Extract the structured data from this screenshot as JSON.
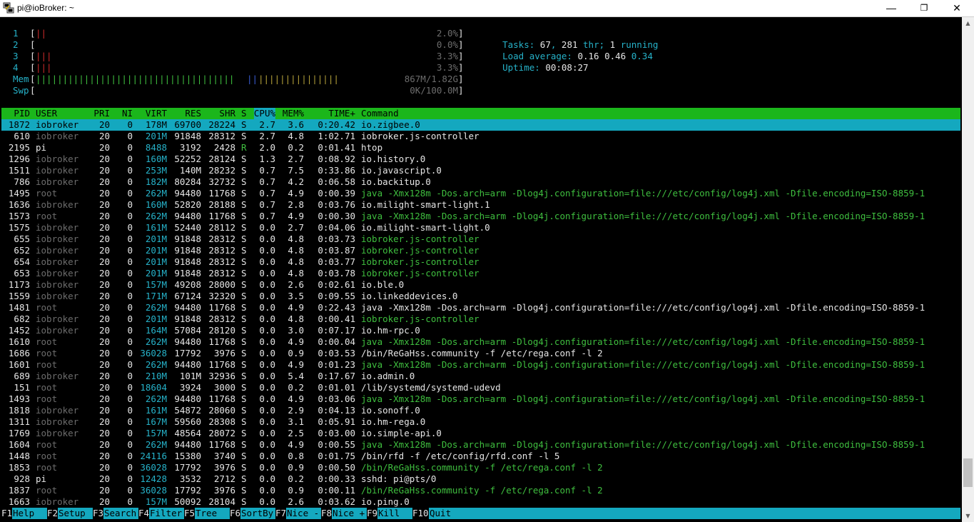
{
  "window": {
    "title": "pi@ioBroker: ~",
    "minimize_glyph": "—",
    "restore_glyph": "❐",
    "close_glyph": "✕",
    "icon": "putty-icon"
  },
  "meters": {
    "cpus": [
      {
        "label": "1",
        "open": "[",
        "bars": "||",
        "value": "2.0%",
        "close": "]"
      },
      {
        "label": "2",
        "open": "[",
        "bars": "",
        "value": "0.0%",
        "close": "]"
      },
      {
        "label": "3",
        "open": "[",
        "bars": "|||",
        "value": "3.3%",
        "close": "]"
      },
      {
        "label": "4",
        "open": "[",
        "bars": "|||",
        "value": "3.3%",
        "close": "]"
      }
    ],
    "mem": {
      "label": "Mem",
      "open": "[",
      "bars_green": "|||||||||||||||||||||||||||||||||||||",
      "bars_blue": "||",
      "bars_yellow": "|||||||||||||||",
      "value": "867M/1.82G",
      "close": "]"
    },
    "swp": {
      "label": "Swp",
      "open": "[",
      "value": "0K/100.0M",
      "close": "]"
    }
  },
  "stats": {
    "tasks_label": "Tasks: ",
    "tasks": "67",
    "thr_sep": ", ",
    "thr": "281",
    "thr_label": " thr; ",
    "running": "1",
    "running_label": " running",
    "load_label": "Load average: ",
    "load1": "0.16",
    "load5": "0.46",
    "load15": "0.34",
    "uptime_label": "Uptime: ",
    "uptime": "00:08:27"
  },
  "columns": {
    "pid": "PID",
    "user": "USER",
    "pri": "PRI",
    "ni": "NI",
    "virt": "VIRT",
    "res": "RES",
    "shr": "SHR",
    "s": "S",
    "cpu": "CPU%",
    "mem": "MEM%",
    "time": "TIME+",
    "command": "Command"
  },
  "processes": [
    {
      "pid": "1872",
      "user": "iobroker",
      "pri": "20",
      "ni": "0",
      "virt": "178M",
      "res": "69700",
      "shr": "28224",
      "s": "S",
      "cpu": "2.7",
      "mem": "3.6",
      "time": "0:20.42",
      "command": "io.zigbee.0",
      "thread": false,
      "selected": true
    },
    {
      "pid": "610",
      "user": "iobroker",
      "pri": "20",
      "ni": "0",
      "virt": "201M",
      "res": "91848",
      "shr": "28312",
      "s": "S",
      "cpu": "2.7",
      "mem": "4.8",
      "time": "1:02.71",
      "command": "iobroker.js-controller",
      "thread": false
    },
    {
      "pid": "2195",
      "user": "pi",
      "pri": "20",
      "ni": "0",
      "virt": "8488",
      "res": "3192",
      "shr": "2428",
      "s": "R",
      "cpu": "2.0",
      "mem": "0.2",
      "time": "0:01.41",
      "command": "htop",
      "thread": false
    },
    {
      "pid": "1296",
      "user": "iobroker",
      "pri": "20",
      "ni": "0",
      "virt": "160M",
      "res": "52252",
      "shr": "28124",
      "s": "S",
      "cpu": "1.3",
      "mem": "2.7",
      "time": "0:08.92",
      "command": "io.history.0",
      "thread": false
    },
    {
      "pid": "1511",
      "user": "iobroker",
      "pri": "20",
      "ni": "0",
      "virt": "253M",
      "res": "140M",
      "shr": "28232",
      "s": "S",
      "cpu": "0.7",
      "mem": "7.5",
      "time": "0:33.86",
      "command": "io.javascript.0",
      "thread": false
    },
    {
      "pid": "786",
      "user": "iobroker",
      "pri": "20",
      "ni": "0",
      "virt": "182M",
      "res": "80284",
      "shr": "32732",
      "s": "S",
      "cpu": "0.7",
      "mem": "4.2",
      "time": "0:06.58",
      "command": "io.backitup.0",
      "thread": false
    },
    {
      "pid": "1495",
      "user": "root",
      "pri": "20",
      "ni": "0",
      "virt": "262M",
      "res": "94480",
      "shr": "11768",
      "s": "S",
      "cpu": "0.7",
      "mem": "4.9",
      "time": "0:00.39",
      "command": "java -Xmx128m -Dos.arch=arm -Dlog4j.configuration=file:///etc/config/log4j.xml -Dfile.encoding=ISO-8859-1",
      "thread": true
    },
    {
      "pid": "1636",
      "user": "iobroker",
      "pri": "20",
      "ni": "0",
      "virt": "160M",
      "res": "52820",
      "shr": "28188",
      "s": "S",
      "cpu": "0.7",
      "mem": "2.8",
      "time": "0:03.76",
      "command": "io.milight-smart-light.1",
      "thread": false
    },
    {
      "pid": "1573",
      "user": "root",
      "pri": "20",
      "ni": "0",
      "virt": "262M",
      "res": "94480",
      "shr": "11768",
      "s": "S",
      "cpu": "0.7",
      "mem": "4.9",
      "time": "0:00.30",
      "command": "java -Xmx128m -Dos.arch=arm -Dlog4j.configuration=file:///etc/config/log4j.xml -Dfile.encoding=ISO-8859-1",
      "thread": true
    },
    {
      "pid": "1575",
      "user": "iobroker",
      "pri": "20",
      "ni": "0",
      "virt": "161M",
      "res": "52440",
      "shr": "28112",
      "s": "S",
      "cpu": "0.0",
      "mem": "2.7",
      "time": "0:04.06",
      "command": "io.milight-smart-light.0",
      "thread": false
    },
    {
      "pid": "655",
      "user": "iobroker",
      "pri": "20",
      "ni": "0",
      "virt": "201M",
      "res": "91848",
      "shr": "28312",
      "s": "S",
      "cpu": "0.0",
      "mem": "4.8",
      "time": "0:03.73",
      "command": "iobroker.js-controller",
      "thread": true
    },
    {
      "pid": "652",
      "user": "iobroker",
      "pri": "20",
      "ni": "0",
      "virt": "201M",
      "res": "91848",
      "shr": "28312",
      "s": "S",
      "cpu": "0.0",
      "mem": "4.8",
      "time": "0:03.87",
      "command": "iobroker.js-controller",
      "thread": true
    },
    {
      "pid": "654",
      "user": "iobroker",
      "pri": "20",
      "ni": "0",
      "virt": "201M",
      "res": "91848",
      "shr": "28312",
      "s": "S",
      "cpu": "0.0",
      "mem": "4.8",
      "time": "0:03.77",
      "command": "iobroker.js-controller",
      "thread": true
    },
    {
      "pid": "653",
      "user": "iobroker",
      "pri": "20",
      "ni": "0",
      "virt": "201M",
      "res": "91848",
      "shr": "28312",
      "s": "S",
      "cpu": "0.0",
      "mem": "4.8",
      "time": "0:03.78",
      "command": "iobroker.js-controller",
      "thread": true
    },
    {
      "pid": "1173",
      "user": "iobroker",
      "pri": "20",
      "ni": "0",
      "virt": "157M",
      "res": "49208",
      "shr": "28000",
      "s": "S",
      "cpu": "0.0",
      "mem": "2.6",
      "time": "0:02.61",
      "command": "io.ble.0",
      "thread": false
    },
    {
      "pid": "1559",
      "user": "iobroker",
      "pri": "20",
      "ni": "0",
      "virt": "171M",
      "res": "67124",
      "shr": "32320",
      "s": "S",
      "cpu": "0.0",
      "mem": "3.5",
      "time": "0:09.55",
      "command": "io.linkeddevices.0",
      "thread": false
    },
    {
      "pid": "1481",
      "user": "root",
      "pri": "20",
      "ni": "0",
      "virt": "262M",
      "res": "94480",
      "shr": "11768",
      "s": "S",
      "cpu": "0.0",
      "mem": "4.9",
      "time": "0:22.43",
      "command": "java -Xmx128m -Dos.arch=arm -Dlog4j.configuration=file:///etc/config/log4j.xml -Dfile.encoding=ISO-8859-1",
      "thread": false
    },
    {
      "pid": "682",
      "user": "iobroker",
      "pri": "20",
      "ni": "0",
      "virt": "201M",
      "res": "91848",
      "shr": "28312",
      "s": "S",
      "cpu": "0.0",
      "mem": "4.8",
      "time": "0:00.41",
      "command": "iobroker.js-controller",
      "thread": true
    },
    {
      "pid": "1452",
      "user": "iobroker",
      "pri": "20",
      "ni": "0",
      "virt": "164M",
      "res": "57084",
      "shr": "28120",
      "s": "S",
      "cpu": "0.0",
      "mem": "3.0",
      "time": "0:07.17",
      "command": "io.hm-rpc.0",
      "thread": false
    },
    {
      "pid": "1610",
      "user": "root",
      "pri": "20",
      "ni": "0",
      "virt": "262M",
      "res": "94480",
      "shr": "11768",
      "s": "S",
      "cpu": "0.0",
      "mem": "4.9",
      "time": "0:00.04",
      "command": "java -Xmx128m -Dos.arch=arm -Dlog4j.configuration=file:///etc/config/log4j.xml -Dfile.encoding=ISO-8859-1",
      "thread": true
    },
    {
      "pid": "1686",
      "user": "root",
      "pri": "20",
      "ni": "0",
      "virt": "36028",
      "res": "17792",
      "shr": "3976",
      "s": "S",
      "cpu": "0.0",
      "mem": "0.9",
      "time": "0:03.53",
      "command": "/bin/ReGaHss.community -f /etc/rega.conf -l 2",
      "thread": false
    },
    {
      "pid": "1601",
      "user": "root",
      "pri": "20",
      "ni": "0",
      "virt": "262M",
      "res": "94480",
      "shr": "11768",
      "s": "S",
      "cpu": "0.0",
      "mem": "4.9",
      "time": "0:01.23",
      "command": "java -Xmx128m -Dos.arch=arm -Dlog4j.configuration=file:///etc/config/log4j.xml -Dfile.encoding=ISO-8859-1",
      "thread": true
    },
    {
      "pid": "689",
      "user": "iobroker",
      "pri": "20",
      "ni": "0",
      "virt": "210M",
      "res": "101M",
      "shr": "32936",
      "s": "S",
      "cpu": "0.0",
      "mem": "5.4",
      "time": "0:17.67",
      "command": "io.admin.0",
      "thread": false
    },
    {
      "pid": "151",
      "user": "root",
      "pri": "20",
      "ni": "0",
      "virt": "18604",
      "res": "3924",
      "shr": "3000",
      "s": "S",
      "cpu": "0.0",
      "mem": "0.2",
      "time": "0:01.01",
      "command": "/lib/systemd/systemd-udevd",
      "thread": false
    },
    {
      "pid": "1493",
      "user": "root",
      "pri": "20",
      "ni": "0",
      "virt": "262M",
      "res": "94480",
      "shr": "11768",
      "s": "S",
      "cpu": "0.0",
      "mem": "4.9",
      "time": "0:03.06",
      "command": "java -Xmx128m -Dos.arch=arm -Dlog4j.configuration=file:///etc/config/log4j.xml -Dfile.encoding=ISO-8859-1",
      "thread": true
    },
    {
      "pid": "1818",
      "user": "iobroker",
      "pri": "20",
      "ni": "0",
      "virt": "161M",
      "res": "54872",
      "shr": "28060",
      "s": "S",
      "cpu": "0.0",
      "mem": "2.9",
      "time": "0:04.13",
      "command": "io.sonoff.0",
      "thread": false
    },
    {
      "pid": "1311",
      "user": "iobroker",
      "pri": "20",
      "ni": "0",
      "virt": "167M",
      "res": "59560",
      "shr": "28308",
      "s": "S",
      "cpu": "0.0",
      "mem": "3.1",
      "time": "0:05.91",
      "command": "io.hm-rega.0",
      "thread": false
    },
    {
      "pid": "1769",
      "user": "iobroker",
      "pri": "20",
      "ni": "0",
      "virt": "157M",
      "res": "48564",
      "shr": "28072",
      "s": "S",
      "cpu": "0.0",
      "mem": "2.5",
      "time": "0:03.00",
      "command": "io.simple-api.0",
      "thread": false
    },
    {
      "pid": "1604",
      "user": "root",
      "pri": "20",
      "ni": "0",
      "virt": "262M",
      "res": "94480",
      "shr": "11768",
      "s": "S",
      "cpu": "0.0",
      "mem": "4.9",
      "time": "0:00.55",
      "command": "java -Xmx128m -Dos.arch=arm -Dlog4j.configuration=file:///etc/config/log4j.xml -Dfile.encoding=ISO-8859-1",
      "thread": true
    },
    {
      "pid": "1448",
      "user": "root",
      "pri": "20",
      "ni": "0",
      "virt": "24116",
      "res": "15380",
      "shr": "3740",
      "s": "S",
      "cpu": "0.0",
      "mem": "0.8",
      "time": "0:01.75",
      "command": "/bin/rfd -f /etc/config/rfd.conf -l 5",
      "thread": false
    },
    {
      "pid": "1853",
      "user": "root",
      "pri": "20",
      "ni": "0",
      "virt": "36028",
      "res": "17792",
      "shr": "3976",
      "s": "S",
      "cpu": "0.0",
      "mem": "0.9",
      "time": "0:00.50",
      "command": "/bin/ReGaHss.community -f /etc/rega.conf -l 2",
      "thread": true
    },
    {
      "pid": "928",
      "user": "pi",
      "pri": "20",
      "ni": "0",
      "virt": "12428",
      "res": "3532",
      "shr": "2712",
      "s": "S",
      "cpu": "0.0",
      "mem": "0.2",
      "time": "0:00.33",
      "command": "sshd: pi@pts/0",
      "thread": false
    },
    {
      "pid": "1837",
      "user": "root",
      "pri": "20",
      "ni": "0",
      "virt": "36028",
      "res": "17792",
      "shr": "3976",
      "s": "S",
      "cpu": "0.0",
      "mem": "0.9",
      "time": "0:00.11",
      "command": "/bin/ReGaHss.community -f /etc/rega.conf -l 2",
      "thread": true
    },
    {
      "pid": "1663",
      "user": "iobroker",
      "pri": "20",
      "ni": "0",
      "virt": "157M",
      "res": "50092",
      "shr": "28104",
      "s": "S",
      "cpu": "0.0",
      "mem": "2.6",
      "time": "0:03.62",
      "command": "io.ping.0",
      "thread": false
    }
  ],
  "function_keys": [
    {
      "key": "F1",
      "label": "Help  "
    },
    {
      "key": "F2",
      "label": "Setup "
    },
    {
      "key": "F3",
      "label": "Search"
    },
    {
      "key": "F4",
      "label": "Filter"
    },
    {
      "key": "F5",
      "label": "Tree  "
    },
    {
      "key": "F6",
      "label": "SortBy"
    },
    {
      "key": "F7",
      "label": "Nice -"
    },
    {
      "key": "F8",
      "label": "Nice +"
    },
    {
      "key": "F9",
      "label": "Kill  "
    },
    {
      "key": "F10",
      "label": "Quit  "
    }
  ],
  "scrollbar": {
    "up_glyph": "▲",
    "down_glyph": "▼",
    "position_fraction": 0.95
  },
  "colors": {
    "header_bg": "#1bb61b",
    "selected_bg": "#14a8bf",
    "cyan": "#26b2c9",
    "thread_green": "#3fbf3f"
  }
}
